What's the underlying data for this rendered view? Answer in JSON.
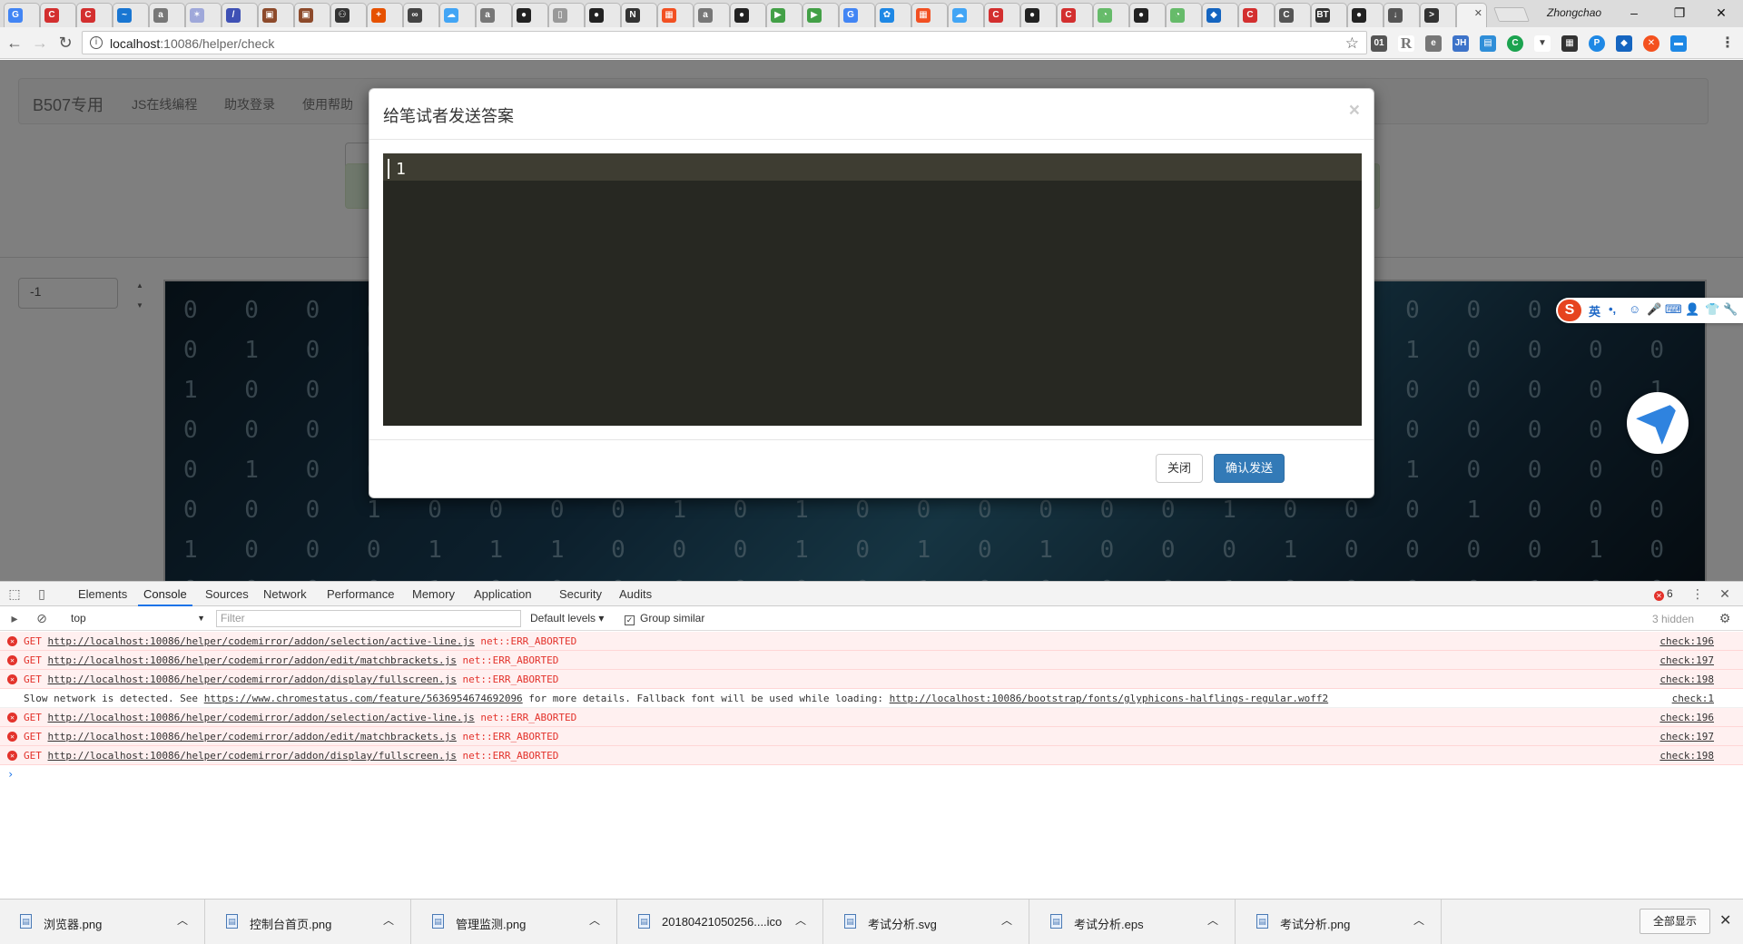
{
  "browser": {
    "profile": "Zhongchao",
    "url_host": "localhost",
    "url_rest": ":10086/helper/check"
  },
  "tab_icons": [
    "chrome-icon",
    "c-red-icon",
    "c-red-icon",
    "blue-icon",
    "a-icon",
    "star-icon",
    "pen-icon",
    "img-icon",
    "img-icon",
    "octocat-icon",
    "plus-icon",
    "link-icon",
    "cloud-icon",
    "a-icon",
    "github-icon",
    "doc-icon",
    "github-icon",
    "n-icon",
    "windows-icon",
    "a-icon",
    "github-icon",
    "play-icon",
    "play-icon",
    "chrome-icon",
    "paw-icon",
    "windows-icon",
    "cloud-icon",
    "c-red-icon",
    "github-icon",
    "c-red-icon",
    "chat-icon",
    "github-icon",
    "chat-icon",
    "arrow-icon",
    "c-red-icon",
    "c-icon",
    "bt-icon",
    "github-icon",
    "download-icon",
    "terminal-icon"
  ],
  "navbar": {
    "brand": "B507专用",
    "links": [
      "JS在线编程",
      "助攻登录",
      "使用帮助"
    ]
  },
  "page": {
    "input_value": "-1"
  },
  "modal": {
    "title": "给笔试者发送答案",
    "close": "×",
    "editor_line": "1",
    "btn_close": "关闭",
    "btn_send": "确认发送"
  },
  "ime": {
    "logo": "S",
    "lang": "英",
    "punct": "•,"
  },
  "devtools": {
    "tabs": [
      "Elements",
      "Console",
      "Sources",
      "Network",
      "Performance",
      "Memory",
      "Application",
      "Security",
      "Audits"
    ],
    "active_tab": "Console",
    "error_count": "6",
    "context": "top",
    "filter_placeholder": "Filter",
    "levels": "Default levels",
    "group_similar": "Group similar",
    "hidden": "3 hidden",
    "messages": [
      {
        "type": "error",
        "method": "GET",
        "url": "http://localhost:10086/helper/codemirror/addon/selection/active-line.js",
        "status": "net::ERR_ABORTED",
        "src": "check:196"
      },
      {
        "type": "error",
        "method": "GET",
        "url": "http://localhost:10086/helper/codemirror/addon/edit/matchbrackets.js",
        "status": "net::ERR_ABORTED",
        "src": "check:197"
      },
      {
        "type": "error",
        "method": "GET",
        "url": "http://localhost:10086/helper/codemirror/addon/display/fullscreen.js",
        "status": "net::ERR_ABORTED",
        "src": "check:198"
      },
      {
        "type": "info",
        "pre": "Slow network is detected. See ",
        "url": "https://www.chromestatus.com/feature/5636954674692096",
        "mid": " for more details. Fallback font will be used while loading: ",
        "url2": "http://localhost:10086/bootstrap/fonts/glyphicons-halflings-regular.woff2",
        "src": "check:1"
      },
      {
        "type": "error",
        "method": "GET",
        "url": "http://localhost:10086/helper/codemirror/addon/selection/active-line.js",
        "status": "net::ERR_ABORTED",
        "src": "check:196"
      },
      {
        "type": "error",
        "method": "GET",
        "url": "http://localhost:10086/helper/codemirror/addon/edit/matchbrackets.js",
        "status": "net::ERR_ABORTED",
        "src": "check:197"
      },
      {
        "type": "error",
        "method": "GET",
        "url": "http://localhost:10086/helper/codemirror/addon/display/fullscreen.js",
        "status": "net::ERR_ABORTED",
        "src": "check:198"
      }
    ]
  },
  "downloads": {
    "items": [
      "浏览器.png",
      "控制台首页.png",
      "管理监测.png",
      "20180421050256....ico",
      "考试分析.svg",
      "考试分析.eps",
      "考试分析.png"
    ],
    "show_all": "全部显示"
  }
}
